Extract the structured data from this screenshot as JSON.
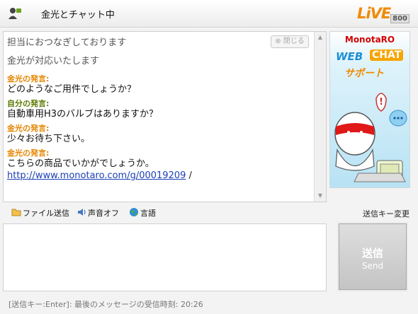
{
  "window": {
    "title": "金光とチャット中",
    "logo_text": "LiVE",
    "logo_number": "800"
  },
  "chat": {
    "close_label": "閉じる",
    "system_lines": [
      "担当におつなぎしております",
      "金光が対応いたします"
    ],
    "messages": [
      {
        "sender": "金光の発言:",
        "role": "operator",
        "text": "どのようなご用件でしょうか？"
      },
      {
        "sender": "自分の発言:",
        "role": "self",
        "text": "自動車用H3のバルブはありますか？"
      },
      {
        "sender": "金光の発言:",
        "role": "operator",
        "text": "少々お待ち下さい。"
      },
      {
        "sender": "金光の発言:",
        "role": "operator",
        "text": "こちらの商品でいかがでしょうか。",
        "link": "http://www.monotaro.com/g/00019209",
        "link_suffix": " /"
      }
    ]
  },
  "ad": {
    "brand": "MonotaRO",
    "line1_a": "WEB",
    "line1_b": "CHAT",
    "line2": "サポート"
  },
  "toolbar": {
    "file_send": "ファイル送信",
    "sound_off": "声音オフ",
    "language": "言語",
    "sendkey_change": "送信キー変更"
  },
  "input": {
    "value": ""
  },
  "send_button": {
    "label": "送信",
    "sub_label": "Send"
  },
  "status": {
    "text": "[送信キー:Enter]:  最後のメッセージの受信時刻:  20:26"
  },
  "colors": {
    "operator": "#e68500",
    "self": "#5b7a00",
    "link": "#1a3fb5",
    "logo": "#f08a00"
  }
}
